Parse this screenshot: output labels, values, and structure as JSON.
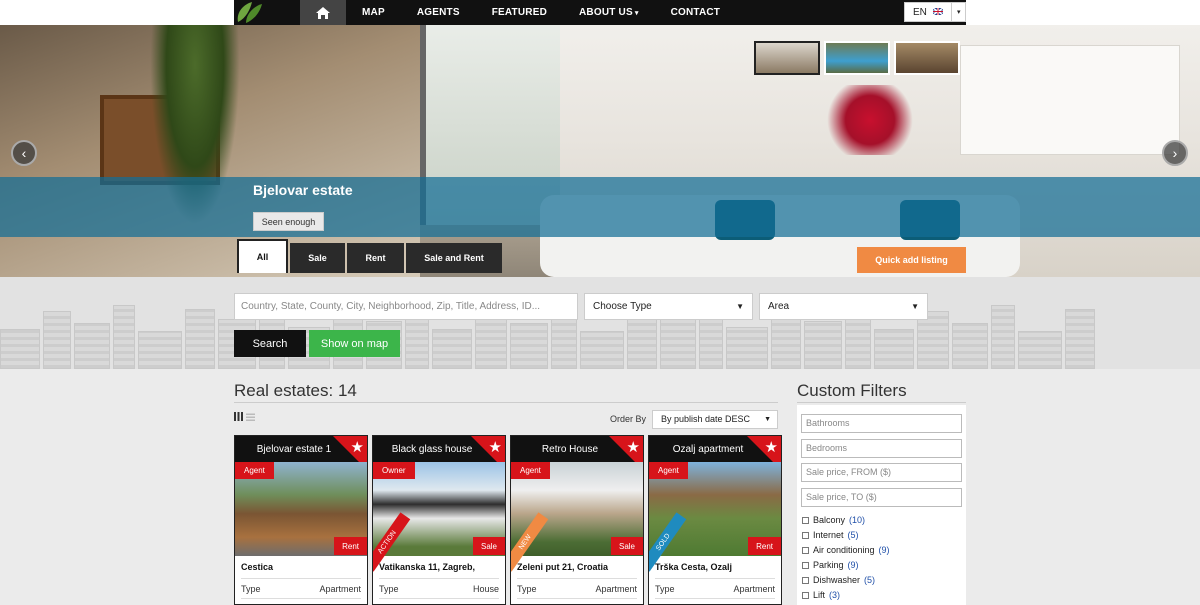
{
  "nav": {
    "items": [
      "MAP",
      "AGENTS",
      "FEATURED",
      "ABOUT US",
      "CONTACT"
    ],
    "about_caret": "▾",
    "lang": "EN",
    "lang_caret": "▾"
  },
  "hero": {
    "title": "Bjelovar estate",
    "cta": "Seen enough",
    "prev_icon": "‹",
    "next_icon": "›"
  },
  "tabs": [
    "All",
    "Sale",
    "Rent",
    "Sale and Rent"
  ],
  "quick_add": "Quick add listing",
  "search": {
    "placeholder": "Country, State, County, City, Neighborhood, Zip, Title, Address, ID...",
    "type_select": "Choose Type",
    "area_select": "Area",
    "search_button": "Search",
    "map_button": "Show on map"
  },
  "listings": {
    "heading": "Real estates: 14",
    "order_label": "Order By",
    "order_value": "By publish date DESC",
    "cards": [
      {
        "title": "Bjelovar estate 1",
        "role": "Agent",
        "deal": "Rent",
        "ribbon": "",
        "address": "Cestica",
        "type_label": "Type",
        "type_value": "Apartment"
      },
      {
        "title": "Black glass house",
        "role": "Owner",
        "deal": "Sale",
        "ribbon": "ACTION",
        "address": "Vatikanska 11, Zagreb,",
        "type_label": "Type",
        "type_value": "House"
      },
      {
        "title": "Retro House",
        "role": "Agent",
        "deal": "Sale",
        "ribbon": "NEW",
        "address": "Zeleni put 21, Croatia",
        "type_label": "Type",
        "type_value": "Apartment"
      },
      {
        "title": "Ozalj apartment",
        "role": "Agent",
        "deal": "Rent",
        "ribbon": "SOLD",
        "address": "Trška Cesta, Ozalj",
        "type_label": "Type",
        "type_value": "Apartment"
      }
    ]
  },
  "filters": {
    "heading": "Custom Filters",
    "inputs": [
      "Bathrooms",
      "Bedrooms",
      "Sale price, FROM ($)",
      "Sale price, TO ($)"
    ],
    "checks": [
      {
        "label": "Balcony",
        "count": "(10)"
      },
      {
        "label": "Internet",
        "count": "(5)"
      },
      {
        "label": "Air conditioning",
        "count": "(9)"
      },
      {
        "label": "Parking",
        "count": "(9)"
      },
      {
        "label": "Dishwasher",
        "count": "(5)"
      },
      {
        "label": "Lift",
        "count": "(3)"
      }
    ]
  },
  "colors": {
    "accent_red": "#d7141a",
    "green": "#3cb54a",
    "orange": "#f08a43",
    "caption_blue": "#146e96"
  }
}
